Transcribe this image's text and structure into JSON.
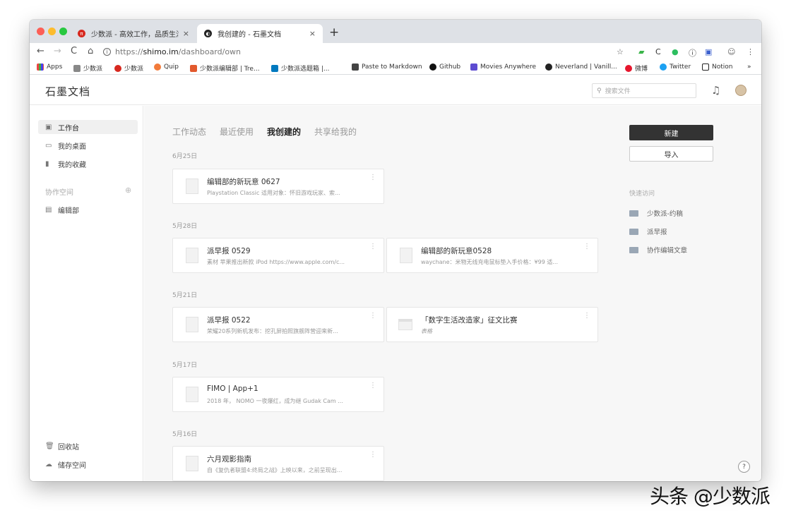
{
  "browser": {
    "tabs": [
      {
        "title": "少数派 - 高效工作，品质生活",
        "close": "×"
      },
      {
        "title": "我创建的 - 石墨文档",
        "close": "×"
      }
    ],
    "new_tab": "+",
    "url_prefix": "https://",
    "url_host": "shimo.im",
    "url_path": "/dashboard/own",
    "bookmarks": [
      "Apps",
      "少数派",
      "少数派",
      "Quip",
      "少数派编辑部 | Tre...",
      "少数派选题箱 |...",
      "Paste to Markdown",
      "Github",
      "Movies Anywhere",
      "Neverland | Vanill...",
      "微博",
      "Twitter",
      "Notion",
      "»"
    ]
  },
  "app": {
    "logo": "石墨文档",
    "search_placeholder": "搜索文件"
  },
  "sidebar": {
    "items": [
      {
        "icon": "▣",
        "label": "工作台"
      },
      {
        "icon": "▭",
        "label": "我的桌面"
      },
      {
        "icon": "▮",
        "label": "我的收藏"
      }
    ],
    "group_label": "协作空间",
    "group_add": "⊕",
    "group_items": [
      {
        "icon": "▤",
        "label": "编辑部"
      }
    ],
    "bottom": [
      {
        "icon": "🗑",
        "label": "回收站"
      },
      {
        "icon": "☁",
        "label": "储存空间"
      }
    ]
  },
  "main": {
    "tabs": [
      "工作动态",
      "最近使用",
      "我创建的",
      "共享给我的"
    ],
    "active_tab": "我创建的",
    "groups": [
      {
        "date": "6月25日",
        "cards": [
          {
            "title": "编辑部的新玩意 0627",
            "sub": "Playstation Classic 适用对象：怀旧游戏玩家、索...",
            "type": "doc"
          }
        ]
      },
      {
        "date": "5月28日",
        "cards": [
          {
            "title": "派早报 0529",
            "sub": "素材 苹果推出新款 iPod https://www.apple.com/c...",
            "type": "doc"
          },
          {
            "title": "编辑部的新玩意0528",
            "sub": "waychane：米物无线充电鼠标垫入手价格：¥99 适...",
            "type": "doc"
          }
        ]
      },
      {
        "date": "5月21日",
        "cards": [
          {
            "title": "派早报 0522",
            "sub": "荣耀20系列新机发布：挖孔屏拍照旗舰阵营迎来新...",
            "type": "doc"
          },
          {
            "title": "「数字生活改造家」征文比赛",
            "sub": "表格",
            "type": "sheet"
          }
        ]
      },
      {
        "date": "5月17日",
        "cards": [
          {
            "title": "FIMO | App+1",
            "sub": "2018 年， NOMO 一夜爆红，成为继 Gudak Cam ...",
            "type": "doc"
          }
        ]
      },
      {
        "date": "5月16日",
        "cards": [
          {
            "title": "六月观影指南",
            "sub": "自《复仇者联盟4:终局之战》上映以来，之前呈现出...",
            "type": "doc"
          }
        ]
      }
    ],
    "card_menu": "⋮"
  },
  "right_panel": {
    "new_label": "新建",
    "import_label": "导入",
    "quick_title": "快速访问",
    "quick_items": [
      "少数派-约稿",
      "派早报",
      "协作编辑文章"
    ]
  },
  "help": "?",
  "watermark": "头条 @少数派"
}
